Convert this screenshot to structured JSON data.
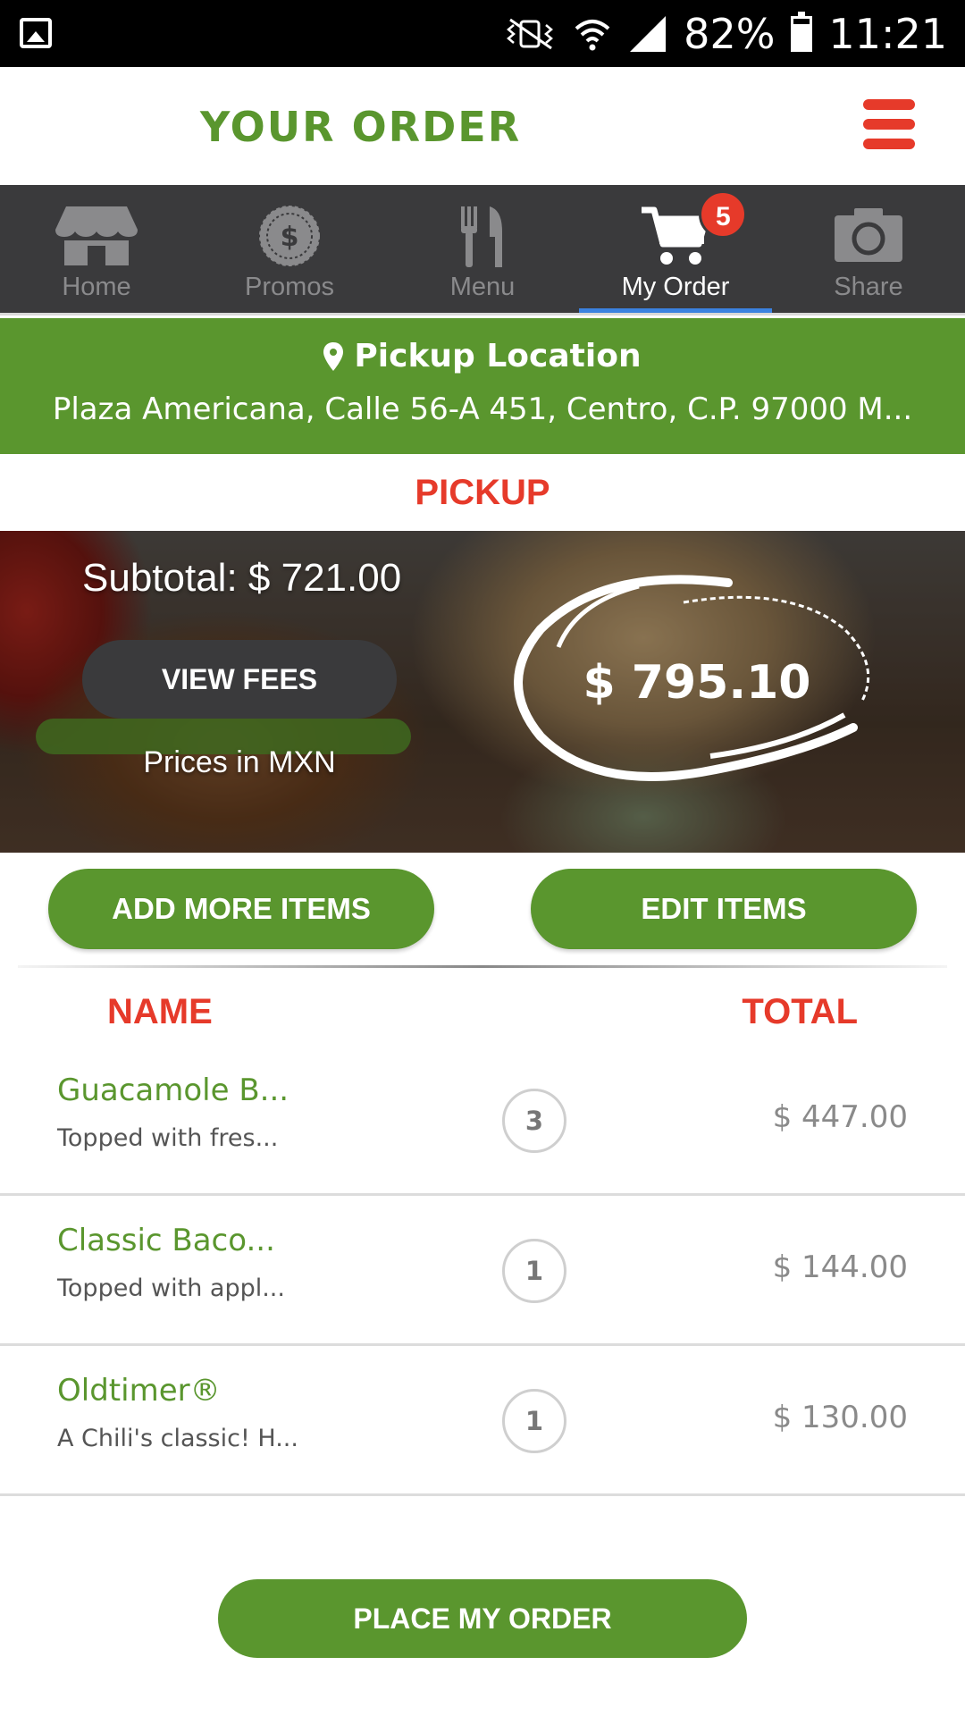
{
  "status_bar": {
    "battery_percent": "82%",
    "battery_level": 0.82,
    "time": "11:21",
    "icons": [
      "gallery-icon",
      "vibrate-mute-icon",
      "wifi-icon",
      "signal-icon",
      "battery-icon"
    ]
  },
  "header": {
    "title": "YOUR ORDER",
    "menu_icon": "hamburger-menu-icon"
  },
  "nav": {
    "items": [
      {
        "label": "Home",
        "icon": "store-icon",
        "active": false
      },
      {
        "label": "Promos",
        "icon": "promo-seal-icon",
        "active": false
      },
      {
        "label": "Menu",
        "icon": "fork-knife-icon",
        "active": false
      },
      {
        "label": "My Order",
        "icon": "cart-icon",
        "active": true,
        "badge": "5"
      },
      {
        "label": "Share",
        "icon": "camera-icon",
        "active": false
      }
    ]
  },
  "location": {
    "title": "Pickup Location",
    "address": "Plaza Americana, Calle 56-A 451, Centro, C.P. 97000 M..."
  },
  "order_mode": "PICKUP",
  "summary": {
    "subtotal": "Subtotal: $ 721.00",
    "view_fees_label": "VIEW FEES",
    "currency_note": "Prices in MXN",
    "total": "$ 795.10"
  },
  "actions": {
    "add_more": "ADD MORE ITEMS",
    "edit": "EDIT ITEMS"
  },
  "table": {
    "headers": {
      "name": "NAME",
      "total": "TOTAL"
    },
    "items": [
      {
        "name": "Guacamole B...",
        "description": "Topped with fres...",
        "qty": "3",
        "price": "$ 447.00"
      },
      {
        "name": "Classic Baco...",
        "description": "Topped with appl...",
        "qty": "1",
        "price": "$ 144.00"
      },
      {
        "name": "Oldtimer®",
        "description": "A Chili's classic! H...",
        "qty": "1",
        "price": "$ 130.00"
      }
    ]
  },
  "place_order": "PLACE MY ORDER",
  "colors": {
    "brand_green": "#5a962e",
    "accent_red": "#e63a2a",
    "nav_bg": "#3a3a3c",
    "nav_active_underline": "#3b82e0"
  }
}
